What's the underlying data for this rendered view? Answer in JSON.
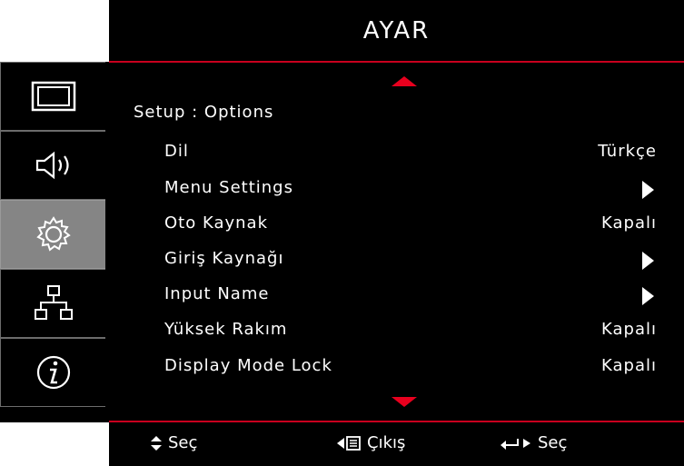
{
  "header": {
    "title": "AYAR"
  },
  "sidebar": {
    "items": [
      {
        "name": "display-icon",
        "active": false
      },
      {
        "name": "audio-icon",
        "active": false
      },
      {
        "name": "settings-gear-icon",
        "active": true
      },
      {
        "name": "network-icon",
        "active": false
      },
      {
        "name": "info-icon",
        "active": false
      }
    ]
  },
  "main": {
    "section_title": "Setup : Options",
    "rows": [
      {
        "label": "Dil",
        "value": "Türkçe",
        "submenu": false
      },
      {
        "label": "Menu Settings",
        "value": "",
        "submenu": true
      },
      {
        "label": "Oto Kaynak",
        "value": "Kapalı",
        "submenu": false
      },
      {
        "label": "Giriş Kaynağı",
        "value": "",
        "submenu": true
      },
      {
        "label": "Input Name",
        "value": "",
        "submenu": true
      },
      {
        "label": "Yüksek Rakım",
        "value": "Kapalı",
        "submenu": false
      },
      {
        "label": "Display Mode Lock",
        "value": "Kapalı",
        "submenu": false
      }
    ]
  },
  "footer": {
    "select_label": "Seç",
    "exit_label": "Çıkış",
    "enter_label": "Seç"
  },
  "colors": {
    "accent": "#e8001e",
    "active_tab": "#858585",
    "background": "#000000"
  }
}
